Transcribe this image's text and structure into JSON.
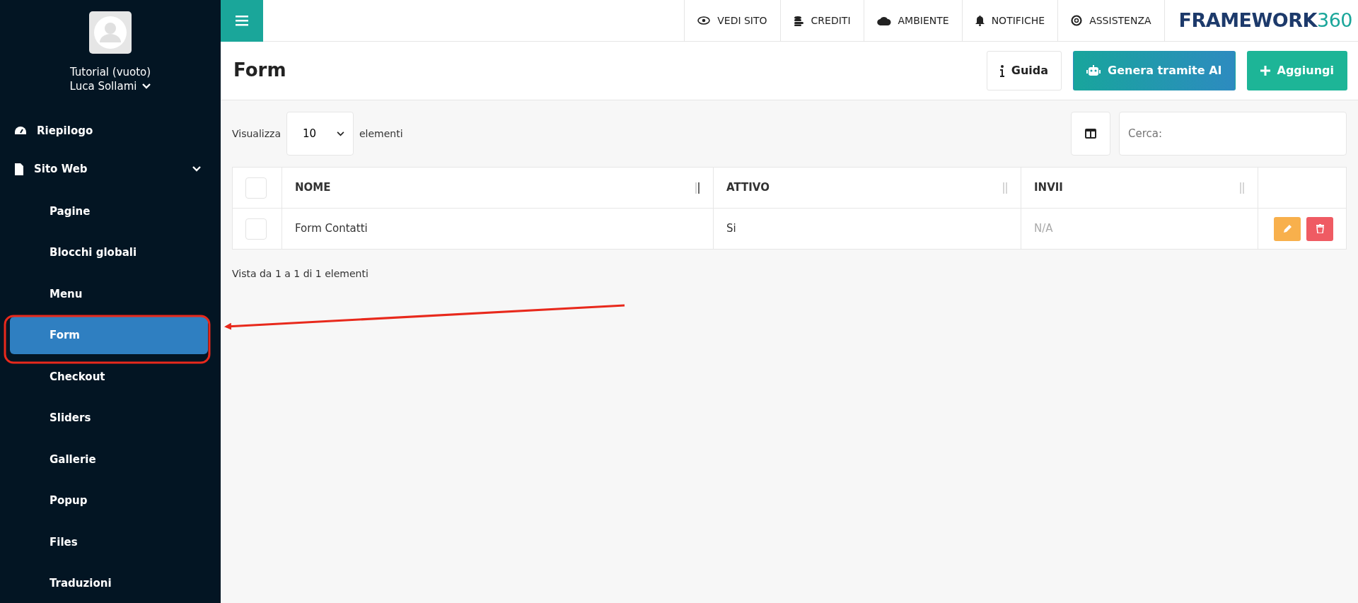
{
  "sidebar": {
    "account": {
      "site": "Tutorial (vuoto)",
      "user": "Luca Sollami"
    },
    "items": [
      {
        "label": "Riepilogo",
        "selected": false
      },
      {
        "label": "Sito Web",
        "selected": false,
        "expanded": true,
        "children": [
          {
            "label": "Pagine",
            "selected": false
          },
          {
            "label": "Blocchi globali",
            "selected": false
          },
          {
            "label": "Menu",
            "selected": false
          },
          {
            "label": "Form",
            "selected": true
          },
          {
            "label": "Checkout",
            "selected": false
          },
          {
            "label": "Sliders",
            "selected": false
          },
          {
            "label": "Gallerie",
            "selected": false
          },
          {
            "label": "Popup",
            "selected": false
          },
          {
            "label": "Files",
            "selected": false
          },
          {
            "label": "Traduzioni",
            "selected": false
          }
        ]
      }
    ]
  },
  "topbar": {
    "links": [
      {
        "label": "VEDI SITO"
      },
      {
        "label": "CREDITI"
      },
      {
        "label": "AMBIENTE"
      },
      {
        "label": "NOTIFICHE"
      },
      {
        "label": "ASSISTENZA"
      }
    ],
    "logo": {
      "word": "FRAMEWORK",
      "number": "360"
    }
  },
  "page": {
    "title": "Form",
    "buttons": [
      {
        "label": "Guida",
        "kind": "light"
      },
      {
        "label": "Genera tramite AI",
        "kind": "gradient"
      },
      {
        "label": "Aggiungi",
        "kind": "teal"
      }
    ]
  },
  "table_controls": {
    "show_label": "Visualizza",
    "page_size": "10",
    "show_suffix": "elementi",
    "search_placeholder": "Cerca:"
  },
  "table": {
    "select_all": {
      "checked": false
    },
    "columns": [
      {
        "label": "NOME",
        "sorted": true
      },
      {
        "label": "ATTIVO",
        "sorted": false
      },
      {
        "label": "INVII",
        "sorted": false
      }
    ],
    "rows": [
      {
        "selected": false,
        "cells": [
          {
            "text": "Form Contatti",
            "muted": false
          },
          {
            "text": "Si",
            "muted": false
          },
          {
            "text": "N/A",
            "muted": true
          }
        ]
      }
    ]
  },
  "info": "Vista da 1 a 1 di 1 elementi"
}
